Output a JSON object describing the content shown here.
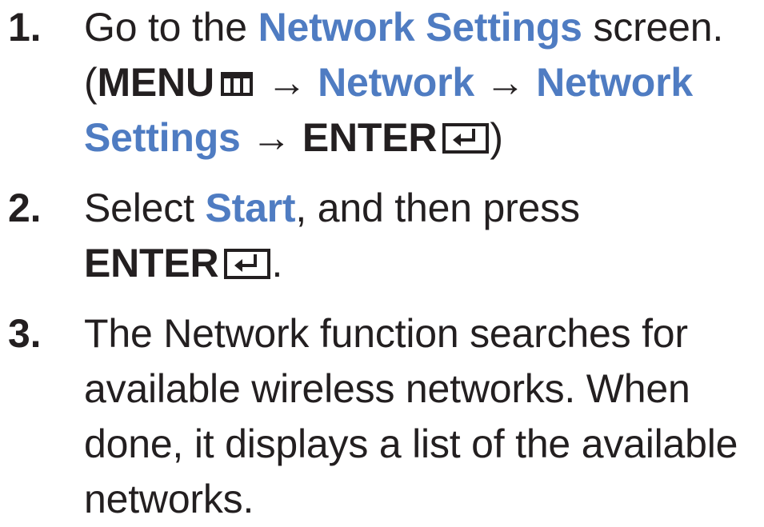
{
  "steps": [
    {
      "number": "1.",
      "text_a": "Go to the ",
      "link_a": "Network Settings",
      "text_b": " screen.",
      "text_c": "(",
      "menu_label": "MENU",
      "arrow_1": " → ",
      "link_b": "Network",
      "arrow_2": " → ",
      "link_c": "Network Settings",
      "arrow_3": " → ",
      "enter_label": "ENTER",
      "text_d": ")"
    },
    {
      "number": "2.",
      "text_a": "Select ",
      "link_a": "Start",
      "text_b": ", and then press ",
      "enter_label": "ENTER",
      "text_c": "."
    },
    {
      "number": "3.",
      "text": "The Network function searches for available wireless networks. When done, it displays a list of the available networks."
    }
  ],
  "icons": {
    "menu": "menu-icon",
    "enter": "enter-icon"
  },
  "colors": {
    "accent": "#4f7cc2",
    "text": "#231f20"
  }
}
